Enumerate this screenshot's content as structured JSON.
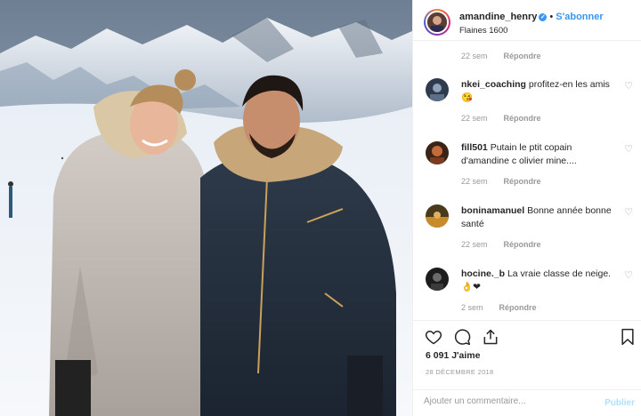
{
  "post": {
    "username": "amandine_henry",
    "verified_badge": "✓",
    "separator": "•",
    "follow_label": "S'abonner",
    "location": "Flaines 1600",
    "likes": "6 091 J'aime",
    "date": "28 DÉCEMBRE 2018"
  },
  "comments_first_meta": {
    "time": "22 sem",
    "reply": "Répondre"
  },
  "comments": [
    {
      "username": "nkei_coaching",
      "text": "profitez-en les amis 😘",
      "time": "22 sem",
      "reply": "Répondre",
      "avatar_color": "#2f3a4f"
    },
    {
      "username": "fill501",
      "text": "Putain le ptit copain d'amandine c olivier mine....",
      "time": "22 sem",
      "reply": "Répondre",
      "avatar_color": "#3a2418"
    },
    {
      "username": "boninamanuel",
      "text": "Bonne année bonne santé",
      "time": "22 sem",
      "reply": "Répondre",
      "avatar_color": "#4a3a1c"
    },
    {
      "username": "hocine._b",
      "text": "La vraie classe de neige. 👌❤",
      "time": "2 sem",
      "reply": "Répondre",
      "avatar_color": "#1c1c1c"
    }
  ],
  "actions": {
    "like_icon": "heart-outline-icon",
    "comment_icon": "comment-bubble-icon",
    "share_icon": "share-icon",
    "save_icon": "bookmark-icon"
  },
  "composer": {
    "placeholder": "Ajouter un commentaire...",
    "post_label": "Publier"
  },
  "colors": {
    "accent": "#3897f0",
    "muted": "#999999",
    "divider": "#efefef"
  }
}
